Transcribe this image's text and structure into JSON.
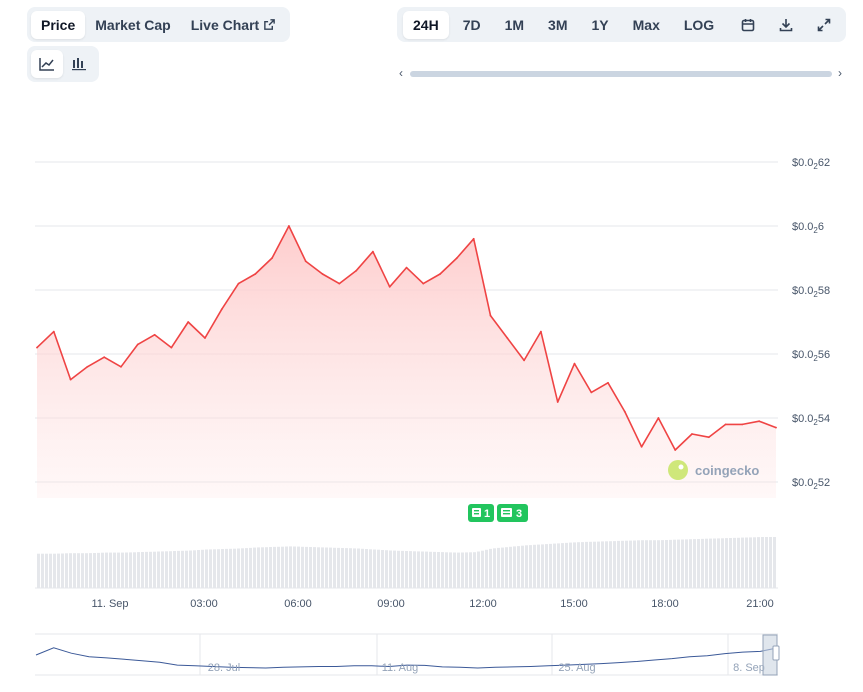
{
  "tabs": {
    "price": "Price",
    "market_cap": "Market Cap",
    "live_chart": "Live Chart"
  },
  "ranges": [
    "24H",
    "7D",
    "1M",
    "3M",
    "1Y",
    "Max",
    "LOG"
  ],
  "active_range": "24H",
  "chart_type_toggle": {
    "line": "line-chart-icon",
    "candle": "candlestick-icon",
    "active": "line"
  },
  "y_labels": [
    {
      "prefix": "$0.0",
      "sub": "2",
      "suffix": "62",
      "value": 2.62e-07
    },
    {
      "prefix": "$0.0",
      "sub": "2",
      "suffix": "6",
      "value": 2.6e-07
    },
    {
      "prefix": "$0.0",
      "sub": "2",
      "suffix": "58",
      "value": 2.58e-07
    },
    {
      "prefix": "$0.0",
      "sub": "2",
      "suffix": "56",
      "value": 2.56e-07
    },
    {
      "prefix": "$0.0",
      "sub": "2",
      "suffix": "54",
      "value": 2.54e-07
    },
    {
      "prefix": "$0.0",
      "sub": "2",
      "suffix": "52",
      "value": 2.52e-07
    }
  ],
  "x_labels": [
    "11. Sep",
    "03:00",
    "06:00",
    "09:00",
    "12:00",
    "15:00",
    "18:00",
    "21:00"
  ],
  "navigator_labels": [
    "28. Jul",
    "11. Aug",
    "25. Aug",
    "8. Sep"
  ],
  "badges": [
    {
      "count": "1"
    },
    {
      "count": "3"
    }
  ],
  "watermark": "coingecko",
  "colors": {
    "line": "#ef4444",
    "fill": "#fecaca",
    "badge": "#22c55e",
    "volume": "#e5e7eb",
    "nav_line": "#3b5998"
  },
  "chart_data": {
    "type": "area",
    "title": "",
    "xlabel": "",
    "ylabel": "",
    "ylim": [
      2.515e-07,
      2.63e-07
    ],
    "x": [
      "00:00",
      "00:30",
      "01:00",
      "01:30",
      "02:00",
      "02:30",
      "03:00",
      "03:30",
      "04:00",
      "04:30",
      "05:00",
      "05:30",
      "06:00",
      "06:30",
      "07:00",
      "07:30",
      "08:00",
      "08:30",
      "09:00",
      "09:30",
      "10:00",
      "10:30",
      "11:00",
      "11:30",
      "12:00",
      "12:30",
      "13:00",
      "13:30",
      "14:00",
      "14:30",
      "15:00",
      "15:30",
      "16:00",
      "16:30",
      "17:00",
      "17:30",
      "18:00",
      "18:30",
      "19:00",
      "19:30",
      "20:00",
      "20:30",
      "21:00",
      "21:30",
      "22:00"
    ],
    "series": [
      {
        "values": [
          2.562e-07,
          2.567e-07,
          2.552e-07,
          2.556e-07,
          2.559e-07,
          2.556e-07,
          2.563e-07,
          2.566e-07,
          2.562e-07,
          2.57e-07,
          2.565e-07,
          2.574e-07,
          2.582e-07,
          2.585e-07,
          2.59e-07,
          2.6e-07,
          2.589e-07,
          2.585e-07,
          2.582e-07,
          2.586e-07,
          2.592e-07,
          2.581e-07,
          2.587e-07,
          2.582e-07,
          2.585e-07,
          2.59e-07,
          2.596e-07,
          2.572e-07,
          2.565e-07,
          2.558e-07,
          2.567e-07,
          2.545e-07,
          2.557e-07,
          2.548e-07,
          2.551e-07,
          2.542e-07,
          2.531e-07,
          2.54e-07,
          2.53e-07,
          2.535e-07,
          2.534e-07,
          2.538e-07,
          2.538e-07,
          2.539e-07,
          2.537e-07
        ]
      }
    ]
  },
  "volume_profile": [
    0.66,
    0.66,
    0.67,
    0.67,
    0.68,
    0.68,
    0.69,
    0.7,
    0.71,
    0.72,
    0.74,
    0.75,
    0.76,
    0.78,
    0.79,
    0.8,
    0.79,
    0.78,
    0.77,
    0.76,
    0.74,
    0.72,
    0.71,
    0.7,
    0.69,
    0.68,
    0.69,
    0.76,
    0.79,
    0.82,
    0.84,
    0.86,
    0.88,
    0.89,
    0.9,
    0.91,
    0.92,
    0.92,
    0.93,
    0.94,
    0.95,
    0.96,
    0.97,
    0.98,
    0.98
  ],
  "navigator_profile": [
    0.5,
    0.3,
    0.45,
    0.55,
    0.58,
    0.62,
    0.66,
    0.7,
    0.78,
    0.8,
    0.82,
    0.84,
    0.85,
    0.86,
    0.84,
    0.83,
    0.82,
    0.82,
    0.8,
    0.8,
    0.82,
    0.78,
    0.79,
    0.83,
    0.84,
    0.86,
    0.84,
    0.83,
    0.82,
    0.8,
    0.78,
    0.76,
    0.74,
    0.71,
    0.68,
    0.64,
    0.6,
    0.55,
    0.52,
    0.46,
    0.42,
    0.4,
    0.3
  ]
}
